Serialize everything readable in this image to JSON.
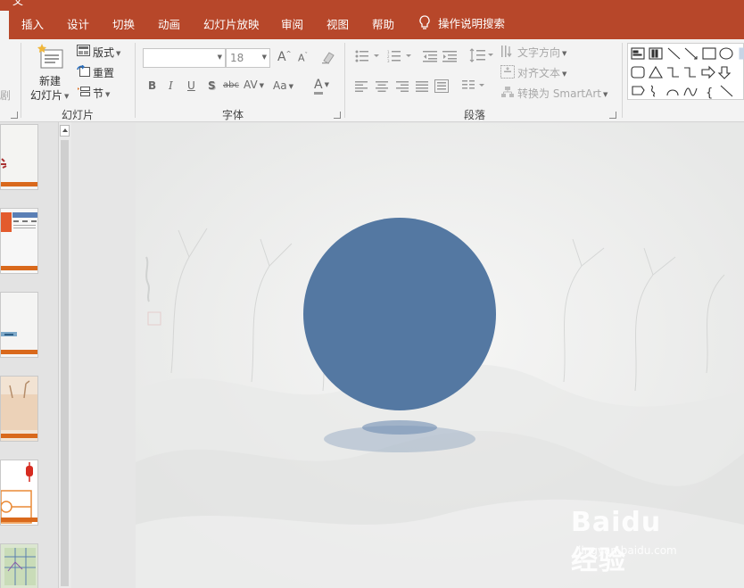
{
  "ribbon": {
    "title_fragment": "文",
    "tabs": [
      {
        "label": "插入"
      },
      {
        "label": "设计"
      },
      {
        "label": "切换"
      },
      {
        "label": "动画"
      },
      {
        "label": "幻灯片放映"
      },
      {
        "label": "审阅"
      },
      {
        "label": "视图"
      },
      {
        "label": "帮助"
      }
    ],
    "tell_me": "操作说明搜索",
    "clip_fragment": "剧"
  },
  "slides_group": {
    "label": "幻灯片",
    "new_slide_line1": "新建",
    "new_slide_line2": "幻灯片",
    "layout": "版式",
    "reset": "重置",
    "section": "节"
  },
  "font_group": {
    "label": "字体",
    "font_name": "",
    "font_size": "18",
    "grow": "A",
    "shrink": "A",
    "bold": "B",
    "italic": "I",
    "underline": "U",
    "shadow": "S",
    "strikethrough": "abc",
    "spacing": "AV",
    "case": "Aa",
    "color": "A"
  },
  "paragraph_group": {
    "label": "段落",
    "text_direction": "文字方向",
    "align_text": "对齐文本",
    "smartart": "转换为 SmartArt"
  },
  "shapes_group": {
    "brace": "{"
  },
  "watermark": {
    "logo": "Baidu 经验",
    "url": "jingyan.baidu.com"
  },
  "colors": {
    "ribbon": "#b7472a",
    "circle": "#5478a2",
    "shadow": "#9eb0c6",
    "thumb_bar": "#d9691c"
  }
}
